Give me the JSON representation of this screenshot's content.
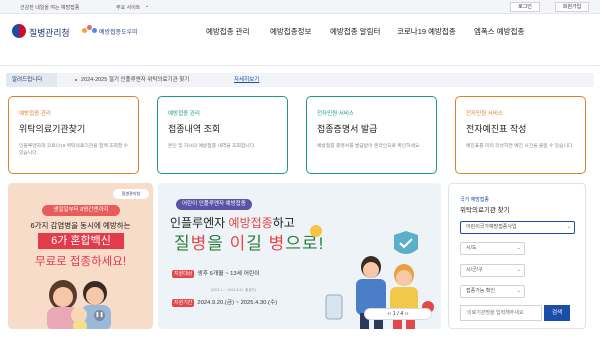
{
  "topbar": {
    "slogan": "건강한 내일을 여는 예방접종",
    "sites_label": "주요 사이트",
    "login": "로그인",
    "signup": "회원가입"
  },
  "header": {
    "org_name": "질병관리청",
    "site_name": "예방접종도우미",
    "nav": [
      "예방접종 관리",
      "예방접종정보",
      "예방접종 알림터",
      "코로나19 예방접종",
      "엠폭스 예방접종"
    ]
  },
  "alert": {
    "tag": "알려드립니다",
    "text": "2024-2025 절기 인플루엔자 위탁의료기관 찾기",
    "link": "자세히보기"
  },
  "cards": [
    {
      "category": "예방접종 관리",
      "title": "위탁의료기관찾기",
      "desc": "인플루엔자와 코로나19 위탁의료기관을 함께 조회할 수 있습니다.",
      "color": "#d9842b"
    },
    {
      "category": "예방접종 관리",
      "title": "접종내역 조회",
      "desc": "본인 및 자녀의 예방접종 내역을 조회합니다.",
      "color": "#1f9a8a"
    },
    {
      "category": "전자민원 서비스",
      "title": "접종증명서 발급",
      "desc": "예방접종 증명서를 발급받아 온라인으로 확인하세요.",
      "color": "#1f9a8a"
    },
    {
      "category": "전자민원 서비스",
      "title": "전자예진표 작성",
      "desc": "예진표를 미리 작성하면 예진 시간을 줄일 수 있습니다.",
      "color": "#d9842b"
    }
  ],
  "banner_left": {
    "badge": "질병관리청",
    "pill": "생일일부터 8명간엔까지",
    "line1": "6가지 감염병을 동시에 예방하는",
    "line2": "6가 혼합백신",
    "line3": "무료로 접종하세요!"
  },
  "banner_mid": {
    "tag": "어린이 인플루엔자 예방접종",
    "headline_a": "인플루엔자 ",
    "headline_em": "예방접종",
    "headline_b": "하고",
    "slogan_a": "질",
    "slogan_em1": "병",
    "slogan_b": "을 ",
    "slogan_em2": "이",
    "slogan_c": "길 ",
    "slogan_em3": "병",
    "slogan_d": "으로!",
    "target_key": "지원대상",
    "target_val": "생후 6개월 ~ 13세 어린이",
    "small": "(2011.1. ~ 2024.8.31. 출생자)",
    "period_key": "지원기간",
    "period_val": "2024.9.20.(금) ~ 2025.4.30.(수)",
    "pager": "1 / 4"
  },
  "panel": {
    "sub": "국가 예방접종",
    "title": "위탁의료기관 찾기",
    "main_select": "어린이국가예방접종사업",
    "select_sido": "시/도",
    "select_sigungu": "시/군/구",
    "select_vaccine": "접종가능 확인",
    "input_placeholder": "의료기관명을 입력해주세요",
    "search_btn": "검색"
  },
  "colors": {
    "brand_blue": "#1b4ea8",
    "accent_red": "#e4474b",
    "orange_card": "#d9842b",
    "teal_card": "#1f9a8a"
  }
}
